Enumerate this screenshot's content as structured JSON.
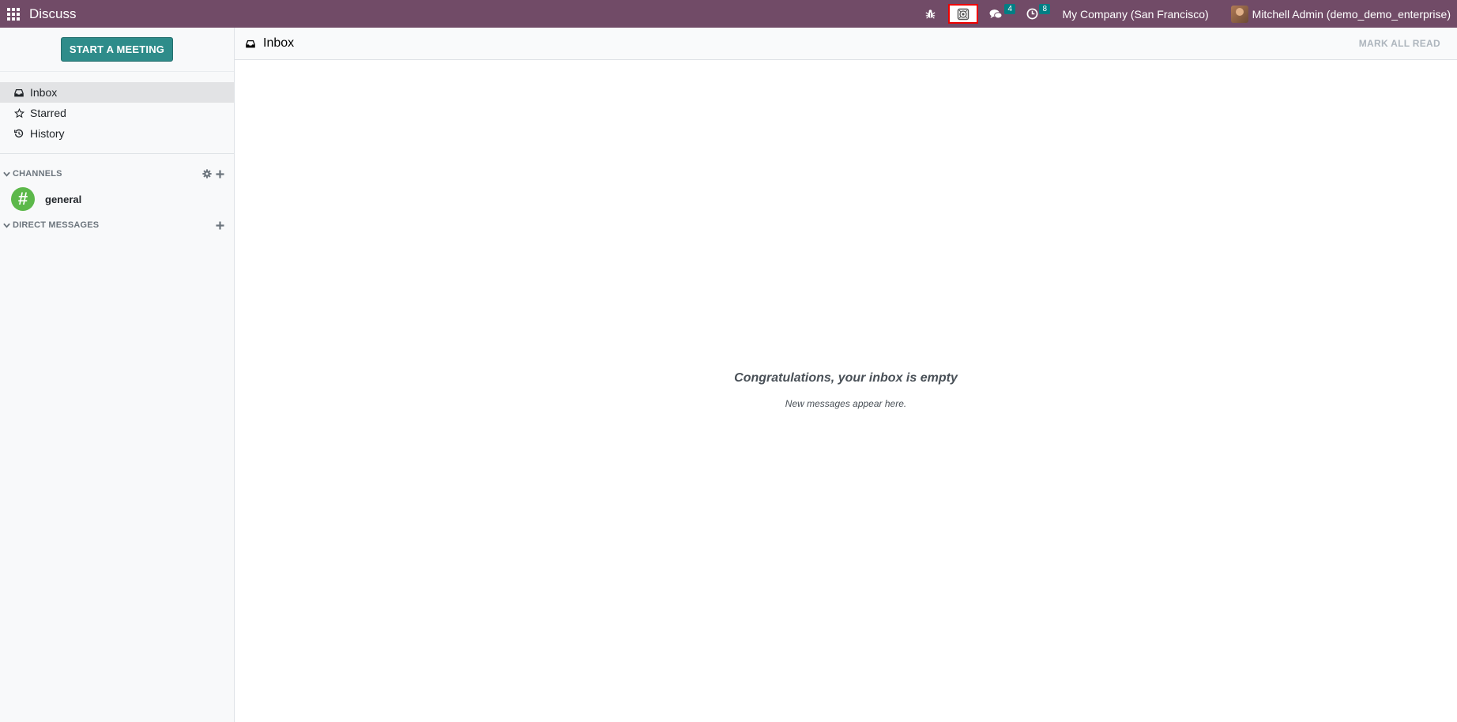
{
  "navbar": {
    "app_title": "Discuss",
    "messages_count": "4",
    "activities_count": "8",
    "company": "My Company (San Francisco)",
    "user": "Mitchell Admin (demo_demo_enterprise)",
    "icons": [
      "apps-grid-icon",
      "bug-icon",
      "voip-icon",
      "comments-icon",
      "clock-icon",
      "avatar"
    ]
  },
  "sidebar": {
    "start_meeting": "START A MEETING",
    "mailboxes": [
      {
        "label": "Inbox",
        "icon": "inbox-icon"
      },
      {
        "label": "Starred",
        "icon": "star-icon"
      },
      {
        "label": "History",
        "icon": "history-icon"
      }
    ],
    "channels_header": "CHANNELS",
    "channels": [
      {
        "name": "general",
        "avatar": "#"
      }
    ],
    "direct_messages_header": "DIRECT MESSAGES"
  },
  "thread": {
    "title": "Inbox",
    "mark_all_read": "MARK ALL READ",
    "empty_title": "Congratulations, your inbox is empty",
    "empty_subtitle": "New messages appear here."
  },
  "colors": {
    "navbar": "#714b67",
    "primary_button": "#2e8c8a",
    "badge": "#017e84",
    "channel_avatar": "#5cb84a",
    "highlight": "#ee0000"
  }
}
